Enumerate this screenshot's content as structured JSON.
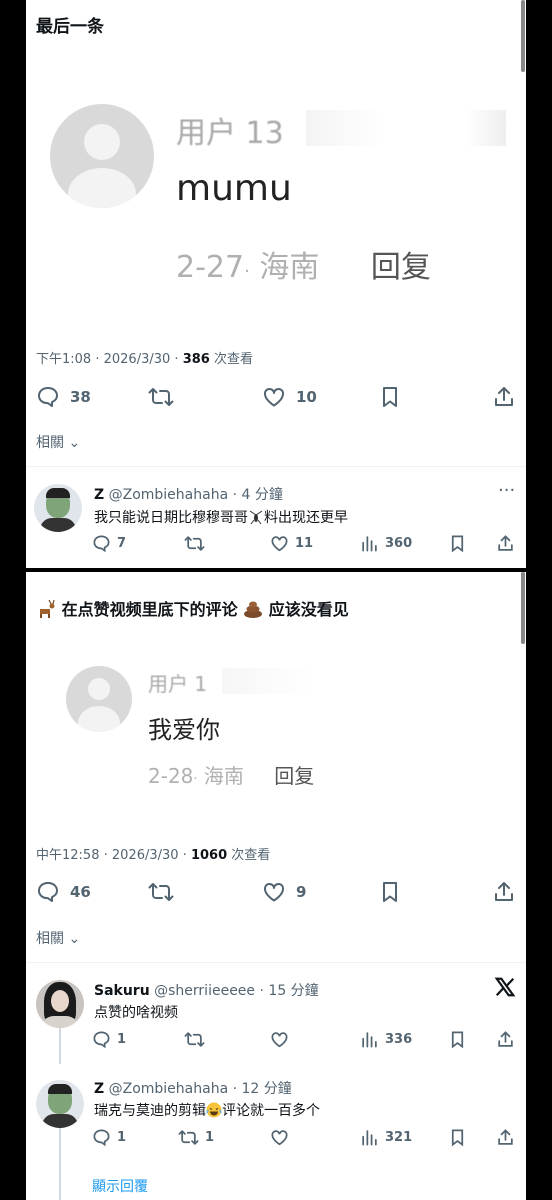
{
  "post1": {
    "header_text": "最后一条",
    "comment_user": "用户 13",
    "comment_text": "mumu",
    "comment_date": "2-27",
    "comment_location": "海南",
    "comment_reply": "回复",
    "meta_time": "下午1:08",
    "meta_date": "2026/3/30",
    "meta_views": "386",
    "meta_views_label": "次查看",
    "replies": "38",
    "likes": "10",
    "related_label": "相關"
  },
  "reply1": {
    "name": "Z",
    "handle": "@Zombiehahaha",
    "time": "4 分鐘",
    "text_before": "我只能说日期比穆穆哥哥",
    "text_after": "料出现还更早",
    "replies": "7",
    "likes": "11",
    "views": "360"
  },
  "post2": {
    "header_before": "在点赞视频里底下的评论",
    "header_after": "应该没看见",
    "comment_user": "用户 1",
    "comment_text": "我爱你",
    "comment_date": "2-28",
    "comment_location": "海南",
    "comment_reply": "回复",
    "meta_time": "中午12:58",
    "meta_date": "2026/3/30",
    "meta_views": "1060",
    "meta_views_label": "次查看",
    "replies": "46",
    "likes": "9",
    "related_label": "相關"
  },
  "reply2": {
    "name": "Sakuru",
    "handle": "@sherriieeeee",
    "time": "15 分鐘",
    "text": "点赞的啥视频",
    "replies": "1",
    "views": "336"
  },
  "reply3": {
    "name": "Z",
    "handle": "@Zombiehahaha",
    "time": "12 分鐘",
    "text_before": "瑞克与莫迪的剪辑",
    "text_after": "评论就一百多个",
    "replies": "1",
    "retweets": "1",
    "views": "321",
    "show_replies": "顯示回覆"
  },
  "colors": {
    "accent": "#1d9bf0",
    "secondary": "#536471",
    "placeholder": "#d9d9d9"
  }
}
